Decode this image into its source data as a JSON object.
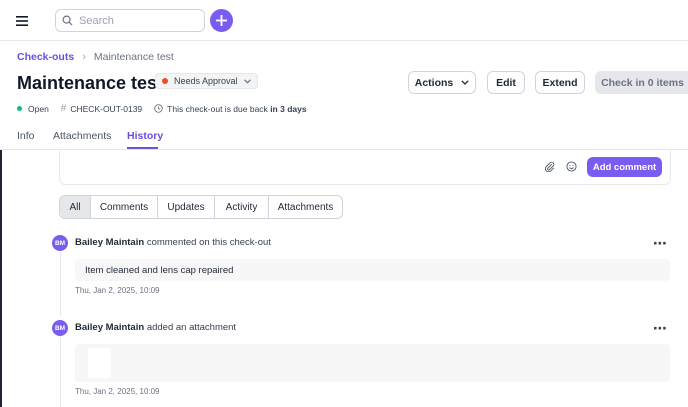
{
  "topbar": {
    "search_placeholder": "Search"
  },
  "breadcrumb": {
    "root": "Check-outs",
    "separator": "›",
    "current": "Maintenance test"
  },
  "header": {
    "title": "Maintenance test",
    "status": "Needs Approval",
    "actions_label": "Actions",
    "edit_label": "Edit",
    "extend_label": "Extend",
    "checkin_label": "Check in 0 items"
  },
  "meta": {
    "state": "Open",
    "code": "CHECK-OUT-0139",
    "due_prefix": "This check-out is due back",
    "due_value": "in 3 days"
  },
  "tabs": [
    {
      "label": "Info"
    },
    {
      "label": "Attachments"
    },
    {
      "label": "History"
    }
  ],
  "comment": {
    "add_label": "Add comment"
  },
  "filters": [
    {
      "label": "All",
      "active": true
    },
    {
      "label": "Comments",
      "active": false
    },
    {
      "label": "Updates",
      "active": false
    },
    {
      "label": "Activity",
      "active": false
    },
    {
      "label": "Attachments",
      "active": false
    }
  ],
  "history": [
    {
      "initials": "BM",
      "user": "Bailey Maintain",
      "action": "commented on this check-out",
      "body": "Item cleaned and lens cap repaired",
      "time": "Thu, Jan 2, 2025, 10:09"
    },
    {
      "initials": "BM",
      "user": "Bailey Maintain",
      "action": "added an attachment",
      "time": "Thu, Jan 2, 2025, 10:09"
    }
  ],
  "colors": {
    "accent": "#7b5cf0",
    "status_dot": "#e8501f",
    "open_dot": "#10b981"
  }
}
